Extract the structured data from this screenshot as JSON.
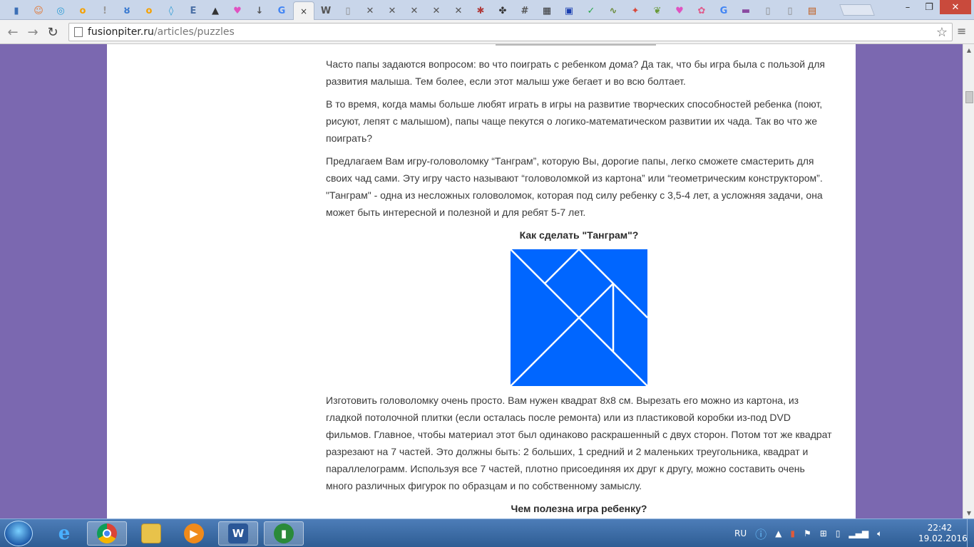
{
  "browser": {
    "url_host": "fusionpiter.ru",
    "url_path": "/articles/puzzles",
    "active_tab_close": "×",
    "tabs": [
      {
        "icon": "book-icon",
        "color": "#3b6fb6",
        "glyph": "▮"
      },
      {
        "icon": "face-icon",
        "color": "#e07a3a",
        "glyph": "☺"
      },
      {
        "icon": "target-icon",
        "color": "#2a9bd4",
        "glyph": "◎"
      },
      {
        "icon": "odnoklassniki-icon",
        "color": "#f5a000",
        "glyph": "о"
      },
      {
        "icon": "exclaim-icon",
        "color": "#999999",
        "glyph": "!"
      },
      {
        "icon": "anchor-icon",
        "color": "#3a7ad0",
        "glyph": "ȣ"
      },
      {
        "icon": "odnoklassniki-icon",
        "color": "#f5a000",
        "glyph": "о"
      },
      {
        "icon": "drop-icon",
        "color": "#2a9bd4",
        "glyph": "◊"
      },
      {
        "icon": "e-icon",
        "color": "#4a6fa5",
        "glyph": "E"
      },
      {
        "icon": "mountain-icon",
        "color": "#333333",
        "glyph": "▲"
      },
      {
        "icon": "heart-icon",
        "color": "#e052c0",
        "glyph": "♥"
      },
      {
        "icon": "download-icon",
        "color": "#555555",
        "glyph": "↓"
      },
      {
        "icon": "google-icon",
        "color": "#4285f4",
        "glyph": "G"
      },
      {
        "icon": "wikipedia-icon",
        "color": "#555555",
        "glyph": "W"
      },
      {
        "icon": "page-icon",
        "color": "#888888",
        "glyph": "▯"
      },
      {
        "icon": "pattern-icon",
        "color": "#555555",
        "glyph": "✕"
      },
      {
        "icon": "pattern-icon",
        "color": "#555555",
        "glyph": "✕"
      },
      {
        "icon": "pattern-icon",
        "color": "#555555",
        "glyph": "✕"
      },
      {
        "icon": "pattern-icon",
        "color": "#555555",
        "glyph": "✕"
      },
      {
        "icon": "pattern-icon",
        "color": "#555555",
        "glyph": "✕"
      },
      {
        "icon": "bug-icon",
        "color": "#b03a3a",
        "glyph": "✱"
      },
      {
        "icon": "flower-icon",
        "color": "#333333",
        "glyph": "✤"
      },
      {
        "icon": "grid-icon",
        "color": "#555555",
        "glyph": "#"
      },
      {
        "icon": "grid-icon",
        "color": "#333333",
        "glyph": "▦"
      },
      {
        "icon": "blue-square-icon",
        "color": "#1a3fb0",
        "glyph": "▣"
      },
      {
        "icon": "check-icon",
        "color": "#2aa84a",
        "glyph": "✓"
      },
      {
        "icon": "chart-icon",
        "color": "#6a8a3a",
        "glyph": "∿"
      },
      {
        "icon": "bird-icon",
        "color": "#d8483a",
        "glyph": "✦"
      },
      {
        "icon": "leaf-icon",
        "color": "#6a9a3a",
        "glyph": "❦"
      },
      {
        "icon": "heart-icon",
        "color": "#e052c0",
        "glyph": "♥"
      },
      {
        "icon": "flower-icon",
        "color": "#e05a8a",
        "glyph": "✿"
      },
      {
        "icon": "google-icon",
        "color": "#4285f4",
        "glyph": "G"
      },
      {
        "icon": "cap-icon",
        "color": "#8a4aa0",
        "glyph": "▬"
      },
      {
        "icon": "page-icon",
        "color": "#888888",
        "glyph": "▯"
      },
      {
        "icon": "page-icon",
        "color": "#888888",
        "glyph": "▯"
      },
      {
        "icon": "calendar-icon",
        "color": "#c05a1a",
        "glyph": "▤"
      }
    ]
  },
  "article": {
    "p1": "Часто папы задаются вопросом: во что поиграть с ребенком дома? Да так, что бы игра была с пользой для развития малыша. Тем более, если этот малыш уже бегает и во всю болтает.",
    "p2": "В то время, когда мамы больше любят играть в игры на развитие творческих способностей ребенка (поют, рисуют, лепят с малышом), папы чаще пекутся о логико-математическом развитии их чада. Так во что же поиграть?",
    "p3": "Предлагаем Вам игру-головоломку “Танграм”, которую Вы, дорогие папы, легко сможете смастерить для своих чад сами. Эту игру часто называют “головоломкой из картона” или “геометрическим конструктором”. \"Танграм\" - одна из несложных головоломок, которая под силу ребенку с 3,5-4 лет, а усложняя задачи, она может быть интересной и полезной и для ребят 5-7 лет.",
    "heading1": "Как сделать \"Танграм\"?",
    "tangram_color": "#0066ff",
    "p4": "Изготовить головоломку очень просто. Вам нужен квадрат 8x8 см. Вырезать его можно из картона, из гладкой потолочной плитки (если осталась после ремонта) или из пластиковой коробки из-под DVD фильмов. Главное, чтобы материал этот был одинаково раскрашенный с двух сторон. Потом тот же квадрат разрезают на 7 частей. Это должны быть: 2 больших, 1 средний и 2 маленьких треугольника, квадрат и параллелограмм. Используя все 7 частей, плотно присоединяя их друг к другу, можно составить очень много различных фигурок по образцам и по собственному замыслу.",
    "heading2": "Чем полезна игра ребенку?"
  },
  "taskbar": {
    "language": "RU",
    "time": "22:42",
    "date": "19.02.2016"
  }
}
